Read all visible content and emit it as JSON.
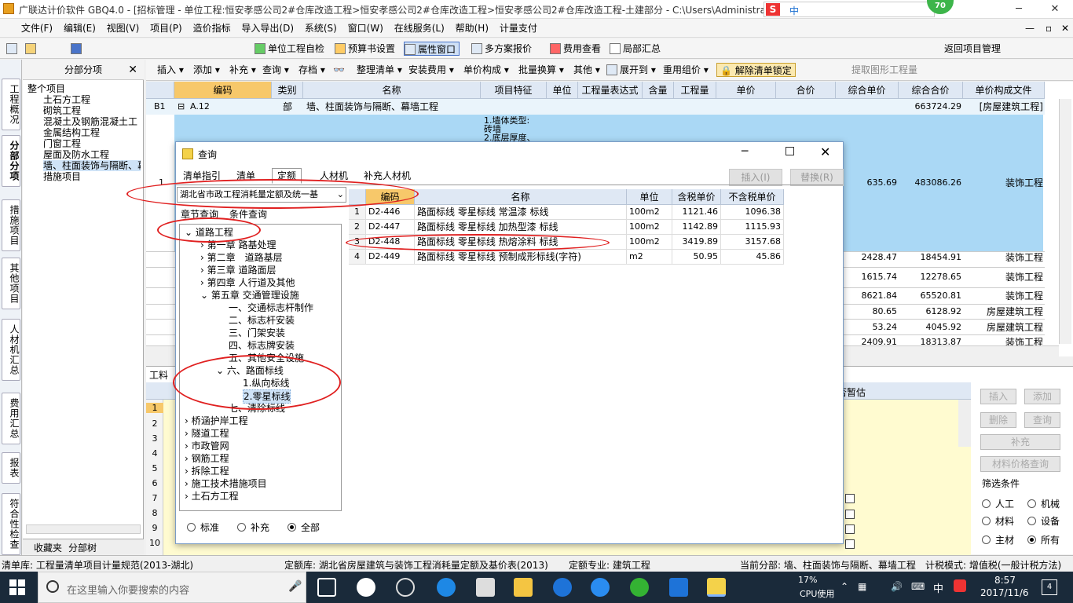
{
  "window": {
    "title": "广联达计价软件 GBQ4.0 - [招标管理 - 单位工程:恒安孝感公司2#仓库改造工程>恒安孝感公司2#仓库改造工程>恒安孝感公司2#仓库改造工程-土建部分 - C:\\Users\\Administrato",
    "tray_badge": "70"
  },
  "menu": [
    "文件(F)",
    "编辑(E)",
    "视图(V)",
    "项目(P)",
    "造价指标",
    "导入导出(D)",
    "系统(S)",
    "窗口(W)",
    "在线服务(L)",
    "帮助(H)",
    "计量支付"
  ],
  "toolbar1": {
    "check": "单位工程自检",
    "preset": "预算书设置",
    "attr": "属性窗口",
    "multi": "多方案报价",
    "fee": "费用查看",
    "local": "局部汇总",
    "back": "返回项目管理"
  },
  "toolbar2": {
    "insert": "插入",
    "add": "添加",
    "supp": "补充",
    "query": "查询",
    "save": "存档",
    "tidy": "整理清单",
    "install": "安装费用",
    "unitprice": "单价构成",
    "batch": "批量换算",
    "other": "其他",
    "expand": "展开到",
    "reuse": "重用组价",
    "unlock": "解除清单锁定",
    "extract": "提取图形工程量"
  },
  "left_tabs": [
    "工程概况",
    "分部分项",
    "措施项目",
    "其他项目",
    "人材机汇总",
    "费用汇总",
    "报表",
    "符合性检查"
  ],
  "nav": {
    "title": "分部分项",
    "items": [
      "整个项目",
      "土石方工程",
      "砌筑工程",
      "混凝土及钢筋混凝土工",
      "金属结构工程",
      "门窗工程",
      "屋面及防水工程",
      "墙、柱面装饰与隔断、幕",
      "措施项目"
    ],
    "tab_fav": "收藏夹",
    "tab_tree": "分部树"
  },
  "grid": {
    "headers": [
      "编码",
      "类别",
      "名称",
      "项目特征",
      "单位",
      "工程量表达式",
      "含量",
      "工程量",
      "单价",
      "合价",
      "综合单价",
      "综合合价",
      "单价构成文件"
    ],
    "row_b1": {
      "id": "B1",
      "code": "A.12",
      "type": "部",
      "name": "墙、柱面装饰与隔断、幕墙工程",
      "total": "663724.29",
      "file": "[房屋建筑工程]"
    },
    "row1": {
      "no": "1",
      "feature": "1.墙体类型:\n砖墙\n2.底层厚度、",
      "uprice": "635.69",
      "total": "483086.26",
      "file": "装饰工程"
    },
    "rows": [
      {
        "uprice": "2428.47",
        "total": "18454.91",
        "file": "装饰工程"
      },
      {
        "uprice": "1615.74",
        "total": "12278.65",
        "file": "装饰工程"
      },
      {
        "uprice": "8621.84",
        "total": "65520.81",
        "file": "装饰工程"
      },
      {
        "uprice": "80.65",
        "total": "6128.92",
        "file": "房屋建筑工程"
      },
      {
        "uprice": "53.24",
        "total": "4045.92",
        "file": "房屋建筑工程"
      },
      {
        "uprice": "2409.91",
        "total": "18313.87",
        "file": "装饰工程"
      }
    ]
  },
  "lower": {
    "tab": "工料",
    "col": "否暂估",
    "rows": [
      "1",
      "2",
      "3",
      "4",
      "5",
      "6",
      "7",
      "8",
      "9",
      "10"
    ],
    "btn_insert": "插入",
    "btn_add": "添加",
    "btn_del": "删除",
    "btn_query": "查询",
    "btn_supp": "补充",
    "btn_price": "材料价格查询",
    "filter_title": "筛选条件",
    "filters": [
      "人工",
      "机械",
      "材料",
      "设备",
      "主材",
      "所有"
    ]
  },
  "dialog": {
    "title": "查询",
    "tabs": [
      "清单指引",
      "清单",
      "定额",
      "人材机",
      "补充人材机"
    ],
    "btn_insert": "插入(I)",
    "btn_replace": "替换(R)",
    "combo": "湖北省市政工程消耗量定额及统一基",
    "subtabs": [
      "章节查询",
      "条件查询"
    ],
    "tree": [
      "道路工程",
      "第一章 路基处理",
      "第二章　道路基层",
      "第三章 道路面层",
      "第四章 人行道及其他",
      "第五章 交通管理设施",
      "一、交通标志杆制作",
      "二、标志杆安装",
      "三、门架安装",
      "四、标志牌安装",
      "五、其他安全设施",
      "六、路面标线",
      "1.纵向标线",
      "2.零星标线",
      "七、清除标线",
      "桥涵护岸工程",
      "隧道工程",
      "市政管网",
      "钢筋工程",
      "拆除工程",
      "施工技术措施项目",
      "土石方工程"
    ],
    "radios": [
      "标准",
      "补充",
      "全部"
    ],
    "table_headers": [
      "编码",
      "名称",
      "单位",
      "含税单价",
      "不含税单价"
    ],
    "table_rows": [
      {
        "n": "1",
        "code": "D2-446",
        "name": "路面标线 零星标线 常温漆 标线",
        "unit": "100m2",
        "tax": "1121.46",
        "notax": "1096.38"
      },
      {
        "n": "2",
        "code": "D2-447",
        "name": "路面标线 零星标线 加热型漆 标线",
        "unit": "100m2",
        "tax": "1142.89",
        "notax": "1115.93"
      },
      {
        "n": "3",
        "code": "D2-448",
        "name": "路面标线 零星标线 热熔涂料 标线",
        "unit": "100m2",
        "tax": "3419.89",
        "notax": "3157.68"
      },
      {
        "n": "4",
        "code": "D2-449",
        "name": "路面标线 零星标线 预制成形标线(字符)",
        "unit": "m2",
        "tax": "50.95",
        "notax": "45.86"
      }
    ]
  },
  "status": {
    "s1": "清单库: 工程量清单项目计量规范(2013-湖北)",
    "s2": "定额库: 湖北省房屋建筑与装饰工程消耗量定额及基价表(2013)",
    "s3": "定额专业: 建筑工程",
    "s4": "当前分部: 墙、柱面装饰与隔断、幕墙工程",
    "s5": "计税模式: 增值税(一般计税方法)"
  },
  "taskbar": {
    "search": "在这里输入你要搜索的内容",
    "cpu_pct": "17%",
    "cpu_label": "CPU使用",
    "ime": "中",
    "time": "8:57",
    "date": "2017/11/6",
    "notif": "4"
  }
}
